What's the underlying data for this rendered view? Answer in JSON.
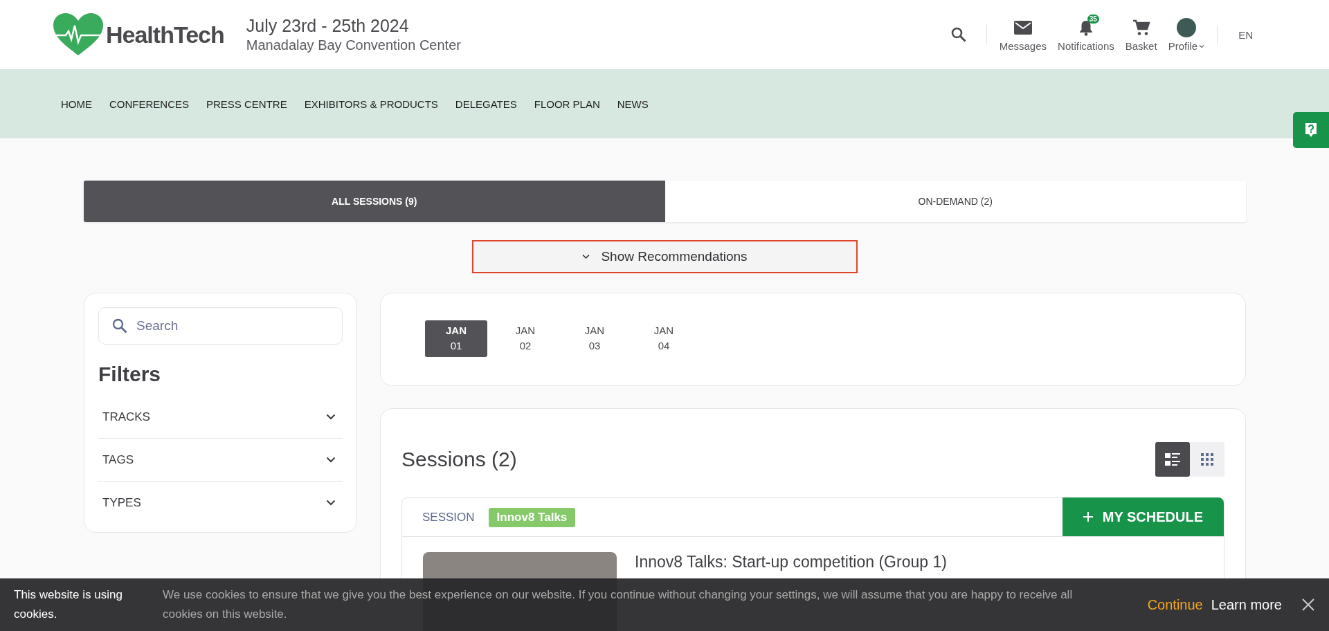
{
  "header": {
    "logo": "HealthTech",
    "dates": "July 23rd - 25th 2024",
    "venue": "Manadalay Bay Convention Center",
    "actions": [
      {
        "kind": "messages",
        "label": "Messages"
      },
      {
        "kind": "notifications",
        "label": "Notifications",
        "badge": "35"
      },
      {
        "kind": "basket",
        "label": "Basket"
      },
      {
        "kind": "profile",
        "label": "Profile"
      }
    ],
    "language": "EN"
  },
  "nav": [
    "HOME",
    "CONFERENCES",
    "PRESS CENTRE",
    "EXHIBITORS & PRODUCTS",
    "DELEGATES",
    "FLOOR PLAN",
    "NEWS"
  ],
  "tabs": [
    {
      "label": "ALL SESSIONS (9)",
      "selected": true
    },
    {
      "label": "ON-DEMAND (2)",
      "selected": false
    }
  ],
  "recommendations": {
    "label": "Show Recommendations"
  },
  "sidebar": {
    "search": {
      "placeholder": "Search"
    },
    "title": "Filters",
    "filters": [
      {
        "label": "TRACKS",
        "expanded": false
      },
      {
        "label": "TAGS",
        "expanded": false
      },
      {
        "label": "TYPES",
        "expanded": false
      }
    ]
  },
  "dates": [
    {
      "month": "JAN",
      "day": "01",
      "selected": true
    },
    {
      "month": "JAN",
      "day": "02",
      "selected": false
    },
    {
      "month": "JAN",
      "day": "03",
      "selected": false
    },
    {
      "month": "JAN",
      "day": "04",
      "selected": false
    }
  ],
  "sessions": {
    "title": "Sessions (2)",
    "views": [
      {
        "kind": "list",
        "selected": true
      },
      {
        "kind": "grid",
        "selected": false
      }
    ],
    "items": [
      {
        "type": "SESSION",
        "tag": "Innov8 Talks",
        "schedule": "MY SCHEDULE",
        "title": "Innov8 Talks: Start-up competition (Group 1)"
      }
    ]
  },
  "cookie": {
    "title": "This website is using cookies.",
    "text": "We use cookies to ensure that we give you the best experience on our website. If you continue without changing your settings, we will assume that you are happy to receive all cookies on this website.",
    "continue": "Continue",
    "learn_more": "Learn more"
  }
}
